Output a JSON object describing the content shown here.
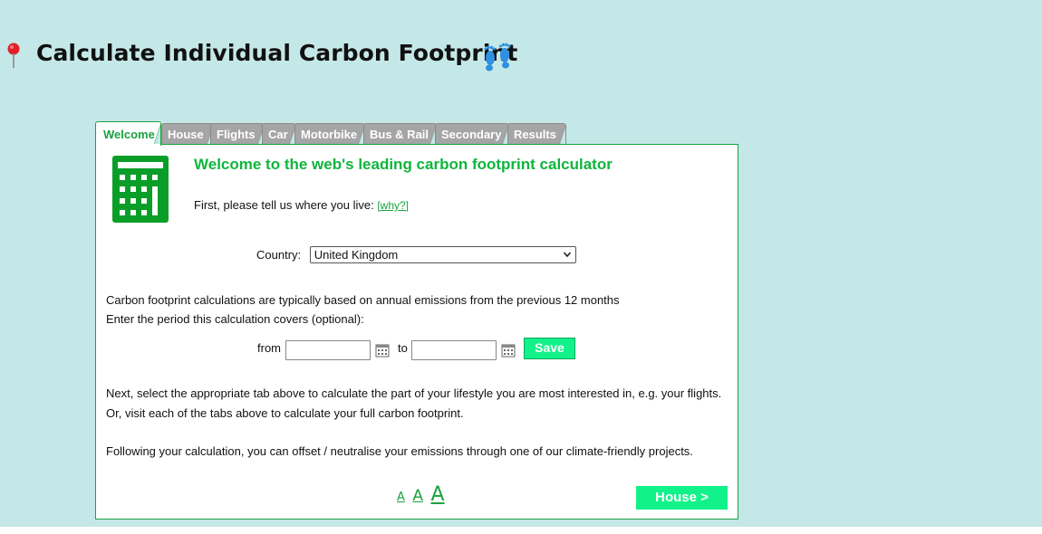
{
  "page": {
    "title": "Calculate Individual Carbon Footprint",
    "icons": [
      "pin-icon",
      "footprints-icon",
      "calculator-icon",
      "calendar-icon"
    ]
  },
  "tabs": [
    {
      "label": "Welcome",
      "active": true
    },
    {
      "label": "House",
      "active": false
    },
    {
      "label": "Flights",
      "active": false
    },
    {
      "label": "Car",
      "active": false
    },
    {
      "label": "Motorbike",
      "active": false
    },
    {
      "label": "Bus & Rail",
      "active": false
    },
    {
      "label": "Secondary",
      "active": false
    },
    {
      "label": "Results",
      "active": false
    }
  ],
  "welcome": {
    "heading": "Welcome to the web's leading carbon footprint calculator",
    "intro": "First, please tell us where you live:",
    "why_link": "[why?]",
    "country_label": "Country:",
    "country_value": "United Kingdom",
    "period_note": "Carbon footprint calculations are typically based on annual emissions from the previous 12 months",
    "period_prompt": "Enter the period this calculation covers (optional):",
    "from_label": "from",
    "to_label": "to",
    "from_value": "",
    "to_value": "",
    "save_label": "Save",
    "next_line1": "Next, select the appropriate tab above to calculate the part of your lifestyle you are most interested in, e.g. your flights.",
    "next_line2": "Or, visit each of the tabs above to calculate your full carbon footprint.",
    "offset_line": "Following your calculation, you can offset / neutralise your emissions through one of our climate-friendly projects.",
    "font_size_small": "A",
    "font_size_medium": "A",
    "font_size_large": "A",
    "next_button": "House >"
  },
  "colors": {
    "background": "#c4e8e7",
    "accent_green": "#1aa33f",
    "heading_green": "#0fb53c",
    "button_green": "#12f28a",
    "tab_inactive": "#a5a5a5"
  }
}
